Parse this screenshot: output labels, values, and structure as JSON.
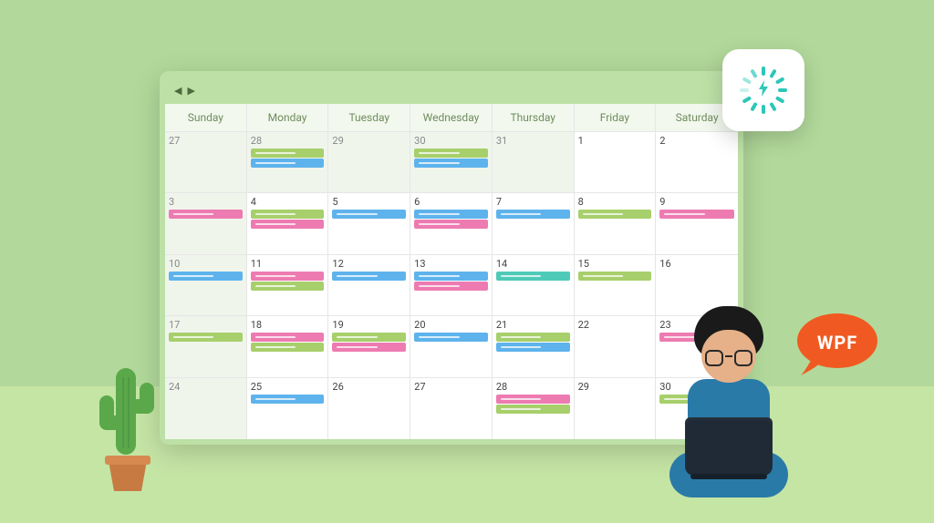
{
  "day_labels": [
    "Sunday",
    "Monday",
    "Tuesday",
    "Wednesday",
    "Thursday",
    "Friday",
    "Saturday"
  ],
  "bubble_text": "WPF",
  "colors": {
    "green": "#a7cf6b",
    "blue": "#5eb3ec",
    "pink": "#ed7bb1",
    "teal": "#4fcab8"
  },
  "weeks": [
    [
      {
        "num": "27",
        "shade": true,
        "events": []
      },
      {
        "num": "28",
        "shade": true,
        "events": [
          "green",
          "blue"
        ]
      },
      {
        "num": "29",
        "shade": true,
        "events": []
      },
      {
        "num": "30",
        "shade": true,
        "events": [
          "green",
          "blue"
        ]
      },
      {
        "num": "31",
        "shade": true,
        "events": []
      },
      {
        "num": "1",
        "events": []
      },
      {
        "num": "2",
        "events": []
      }
    ],
    [
      {
        "num": "3",
        "shade": true,
        "events": [
          "pink"
        ]
      },
      {
        "num": "4",
        "events": [
          "green",
          "pink"
        ]
      },
      {
        "num": "5",
        "events": [
          "blue"
        ]
      },
      {
        "num": "6",
        "events": [
          "blue",
          "pink"
        ]
      },
      {
        "num": "7",
        "events": [
          "blue"
        ]
      },
      {
        "num": "8",
        "events": [
          "green"
        ]
      },
      {
        "num": "9",
        "events": [
          "pink"
        ]
      }
    ],
    [
      {
        "num": "10",
        "shade": true,
        "events": [
          "blue"
        ]
      },
      {
        "num": "11",
        "events": [
          "pink",
          "green"
        ]
      },
      {
        "num": "12",
        "events": [
          "blue"
        ]
      },
      {
        "num": "13",
        "events": [
          "blue",
          "pink"
        ]
      },
      {
        "num": "14",
        "events": [
          "teal"
        ]
      },
      {
        "num": "15",
        "events": [
          "green"
        ]
      },
      {
        "num": "16",
        "events": []
      }
    ],
    [
      {
        "num": "17",
        "shade": true,
        "events": [
          "green"
        ]
      },
      {
        "num": "18",
        "events": [
          "pink",
          "green"
        ]
      },
      {
        "num": "19",
        "events": [
          "green",
          "pink"
        ]
      },
      {
        "num": "20",
        "events": [
          "blue"
        ]
      },
      {
        "num": "21",
        "events": [
          "green",
          "blue"
        ]
      },
      {
        "num": "22",
        "events": []
      },
      {
        "num": "23",
        "events": [
          "pink"
        ]
      }
    ],
    [
      {
        "num": "24",
        "shade": true,
        "events": []
      },
      {
        "num": "25",
        "events": [
          "blue"
        ]
      },
      {
        "num": "26",
        "events": []
      },
      {
        "num": "27",
        "events": []
      },
      {
        "num": "28",
        "events": [
          "pink",
          "green"
        ]
      },
      {
        "num": "29",
        "events": []
      },
      {
        "num": "30",
        "events": [
          "green"
        ]
      }
    ]
  ]
}
